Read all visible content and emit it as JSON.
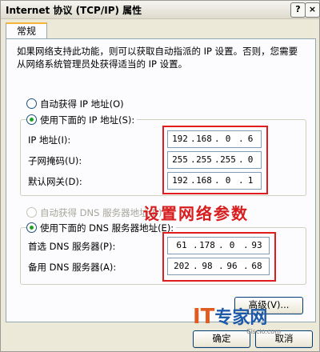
{
  "window": {
    "title": "Internet 协议 (TCP/IP) 属性",
    "help_button": "?",
    "close_button": "×"
  },
  "tabs": [
    {
      "label": "常规"
    }
  ],
  "intro_text": "如果网络支持此功能，则可以获取自动指派的 IP 设置。否则，您需要从网络系统管理员处获得适当的 IP 设置。",
  "ip_section": {
    "auto_option": "自动获得 IP 地址(O)",
    "manual_option": "使用下面的 IP 地址(S):",
    "selected": "manual",
    "fields": [
      {
        "label": "IP 地址(I):",
        "octets": [
          "192",
          "168",
          "0",
          "6"
        ]
      },
      {
        "label": "子网掩码(U):",
        "octets": [
          "255",
          "255",
          "255",
          "0"
        ]
      },
      {
        "label": "默认网关(D):",
        "octets": [
          "192",
          "168",
          "0",
          "1"
        ]
      }
    ]
  },
  "dns_section": {
    "auto_option": "自动获得 DNS 服务器地址(B)",
    "auto_option_disabled": true,
    "manual_option": "使用下面的 DNS 服务器地址(E):",
    "selected": "manual",
    "fields": [
      {
        "label": "首选 DNS 服务器(P):",
        "octets": [
          "61",
          "178",
          "0",
          "93"
        ]
      },
      {
        "label": "备用 DNS 服务器(A):",
        "octets": [
          "202",
          "98",
          "96",
          "68"
        ]
      }
    ]
  },
  "annotation": "设置网络参数",
  "buttons": {
    "advanced": "高级(V)...",
    "ok": "确定",
    "cancel": "取消"
  },
  "watermark": {
    "it": "IT",
    "name": "专家网",
    "site": "Ciscio.com"
  },
  "colors": {
    "highlight_red": "#e01c1c",
    "radio_selected": "#21a121",
    "tab_accent": "#f8b339"
  }
}
